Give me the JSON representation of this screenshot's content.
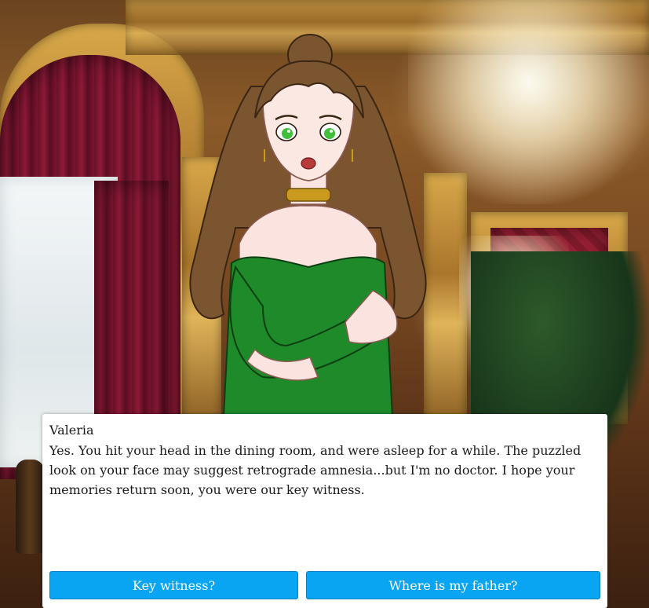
{
  "dialogue": {
    "speaker": "Valeria",
    "text": "Yes. You hit your head in the dining room, and were asleep for a while. The puzzled look on your face may suggest retrograde amnesia...but I'm no doctor. I hope your memories return soon, you were our key witness."
  },
  "choices": [
    {
      "label": "Key witness?"
    },
    {
      "label": "Where is my father?"
    }
  ],
  "colors": {
    "choice_button": "#0aa5f2",
    "dialogue_bg": "#ffffff",
    "dress": "#1f8a2a",
    "hair": "#7a5530"
  }
}
